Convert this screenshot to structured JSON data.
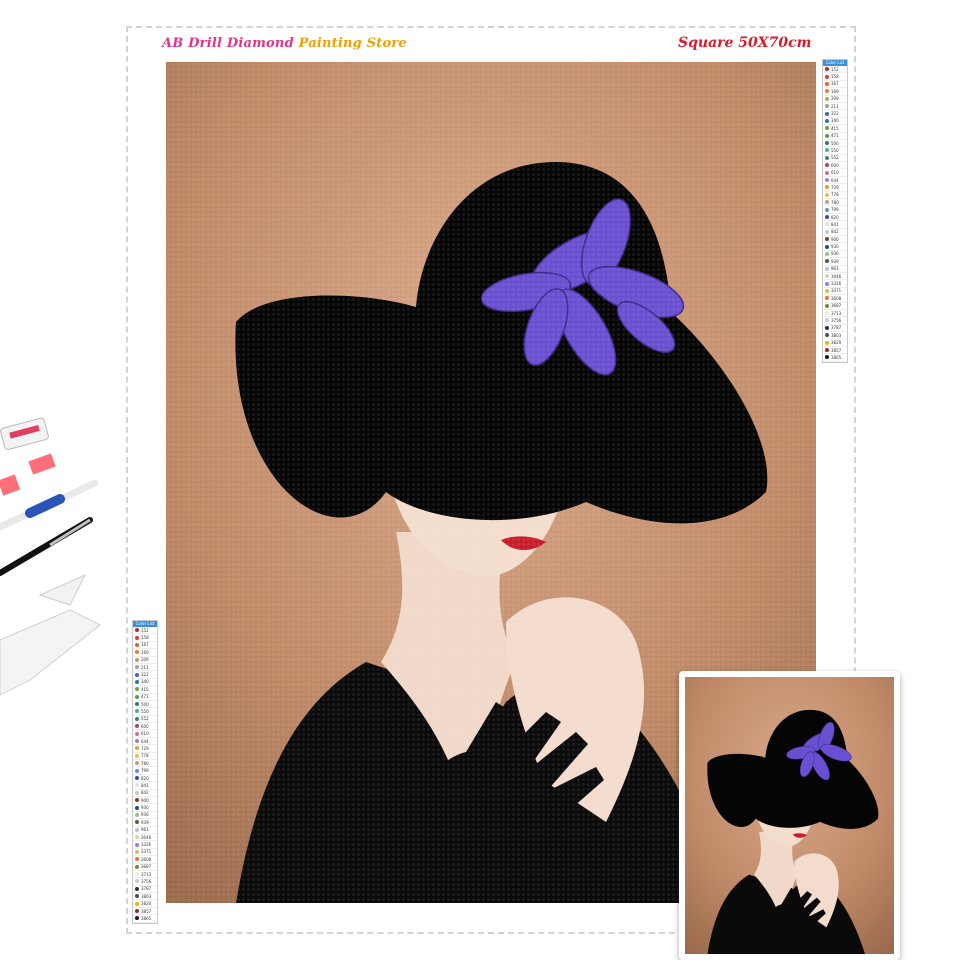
{
  "header": {
    "store_name_part1": "AB Drill Diamond",
    "store_name_part2": "Painting Store",
    "size": "Square 50X70cm"
  },
  "color_list": {
    "title": "Color List",
    "codes": [
      "152",
      "158",
      "167",
      "169",
      "209",
      "211",
      "322",
      "340",
      "415",
      "471",
      "500",
      "550",
      "552",
      "600",
      "610",
      "644",
      "729",
      "778",
      "780",
      "799",
      "820",
      "841",
      "842",
      "900",
      "930",
      "936",
      "939",
      "961",
      "3046",
      "3326",
      "3371",
      "3608",
      "3687",
      "3713",
      "3756",
      "3787",
      "3803",
      "3820",
      "3857",
      "3865"
    ]
  },
  "palette": {
    "background": "#c08a68",
    "hat": "#050505",
    "flower": "#6a4fd0",
    "skin": "#f2d9c9",
    "lips": "#c81e2a",
    "glove": "#0a0a0a"
  }
}
